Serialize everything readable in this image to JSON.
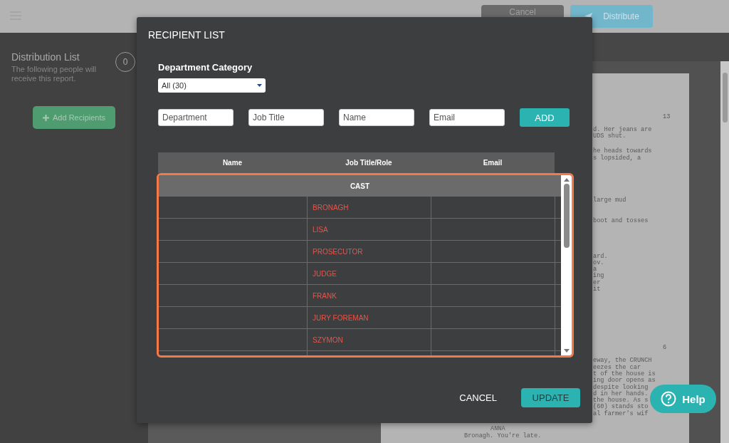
{
  "header": {
    "buttons": [
      {
        "label": "Cancel",
        "kind": "secondary"
      },
      {
        "label": "Distribute",
        "kind": "primary"
      }
    ]
  },
  "distribution": {
    "title": "Distribution List",
    "description": "The following people will receive this report.",
    "count": "0",
    "add_button": "Add Recipients"
  },
  "script_pages": [
    {
      "number": "13",
      "paragraphs": [
        [
          "d. Her jeans are",
          "UDS shut."
        ],
        [
          "he heads towards",
          "s lopsided, a"
        ],
        [
          "large mud"
        ],
        [
          "boot and tosses"
        ],
        [
          "ard.",
          "ov.",
          "a",
          "ing",
          "er",
          "it"
        ]
      ]
    },
    {
      "number": "6",
      "paragraphs": [
        [
          "eway, the CRUNCH",
          "eezes the car",
          "t of the house is",
          "ing door opens as",
          "despite looking",
          "d in her hands.",
          "the house. As s",
          "(60) stands sto",
          "al farmer's wif"
        ]
      ],
      "character": "ANNA",
      "dialogue": "Bronagh. You're late."
    }
  ],
  "dialog": {
    "title": "RECIPIENT LIST",
    "category_label": "Department Category",
    "category": {
      "value": "All (30)"
    },
    "fields": [
      {
        "placeholder": "Department"
      },
      {
        "placeholder": "Job Title"
      },
      {
        "placeholder": "Name"
      },
      {
        "placeholder": "Email"
      }
    ],
    "add_button": "ADD",
    "table": {
      "columns": [
        "Name",
        "Job Title/Role",
        "Email"
      ],
      "groups": [
        {
          "label": "CAST",
          "rows": [
            {
              "job_title": "BRONAGH"
            },
            {
              "job_title": "LISA"
            },
            {
              "job_title": "PROSECUTOR"
            },
            {
              "job_title": "JUDGE"
            },
            {
              "job_title": "FRANK"
            },
            {
              "job_title": "JURY FOREMAN"
            },
            {
              "job_title": "SZYMON"
            }
          ]
        }
      ]
    },
    "buttons": [
      {
        "label": "CANCEL",
        "kind": "text"
      },
      {
        "label": "UPDATE",
        "kind": "primary"
      }
    ]
  },
  "help_button": "Help"
}
